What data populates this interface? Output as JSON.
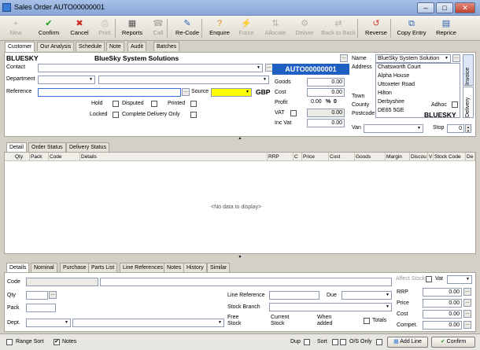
{
  "window": {
    "title": "Sales Order AUTO00000001"
  },
  "toolbar": {
    "buttons": [
      {
        "label": "New",
        "icon": "+",
        "disabled": true
      },
      {
        "label": "Confirm",
        "icon": "✔",
        "disabled": false
      },
      {
        "label": "Cancel",
        "icon": "✖",
        "disabled": false
      },
      {
        "label": "Print",
        "icon": "⎙",
        "disabled": true
      },
      {
        "label": "Reports",
        "icon": "▦",
        "disabled": false
      },
      {
        "label": "Call",
        "icon": "☎",
        "disabled": true
      },
      {
        "label": "Re-Code",
        "icon": "✎",
        "disabled": false
      },
      {
        "label": "Enquire",
        "icon": "?",
        "disabled": false
      },
      {
        "label": "Force",
        "icon": "⚡",
        "disabled": true
      },
      {
        "label": "Allocate",
        "icon": "⇅",
        "disabled": true
      },
      {
        "label": "Deliver",
        "icon": "⚙",
        "disabled": true
      },
      {
        "label": "Back to Back",
        "icon": "⇄",
        "disabled": true
      },
      {
        "label": "Reverse",
        "icon": "↺",
        "disabled": false
      },
      {
        "label": "Copy Entry",
        "icon": "⧉",
        "disabled": false
      },
      {
        "label": "Reprice",
        "icon": "▤",
        "disabled": false
      }
    ]
  },
  "main_tabs": [
    "Customer",
    "Our Analysis",
    "Schedule",
    "Note",
    "Audit",
    "Batches"
  ],
  "customer": {
    "account": "BLUESKY",
    "company": "BlueSky System Solutions",
    "contact_label": "Contact",
    "department_label": "Department",
    "reference_label": "Reference",
    "source_label": "Source",
    "currency": "GBP",
    "hold_label": "Hold",
    "disputed_label": "Disputed",
    "printed_label": "Printed",
    "locked_label": "Locked",
    "complete_label": "Complete Delivery Only"
  },
  "order": {
    "number": "AUTO00000001",
    "goods_label": "Goods",
    "goods": "0.00",
    "cost_label": "Cost",
    "cost": "0.00",
    "profit_label": "Profit",
    "profit": "0.00",
    "profit_unit": "%",
    "profit_pct": "0",
    "vat_label": "VAT",
    "vat": "0.00",
    "incvat_label": "Inc Vat",
    "incvat": "0.00"
  },
  "address": {
    "name_label": "Name",
    "name": "BlueSky System Solution",
    "address_label": "Address",
    "lines": [
      "Chatsworth Court",
      "Alpha House",
      "Uttoxeter Road",
      "Hilton",
      "Derbyshire",
      "DE65 5GE"
    ],
    "town_label": "Town",
    "county_label": "County",
    "postcode_label": "Postcode",
    "adhoc_label": "Adhoc",
    "code": "BLUESKY",
    "van_label": "Van",
    "stop_label": "Stop",
    "stop": "0",
    "side_tabs": [
      "Invoice",
      "Delivery"
    ]
  },
  "detail_tabs": [
    "Detail",
    "Order Status",
    "Delivery Status"
  ],
  "grid": {
    "columns": [
      "Qty",
      "Pack",
      "Code",
      "Details",
      "RRP",
      "C",
      "Price",
      "Cost",
      "Goods",
      "Margin",
      "Discou",
      "V",
      "Stock Code",
      "De"
    ],
    "empty": "<No data to display>"
  },
  "bottom_tabs": [
    "Details",
    "Nominal",
    "Purchase",
    "Parts List",
    "Line References",
    "Notes",
    "History",
    "Similar"
  ],
  "line": {
    "code_label": "Code",
    "qty_label": "Qty",
    "pack_label": "Pack",
    "dept_label": "Dept.",
    "line_ref_label": "Line Reference",
    "due_label": "Due",
    "stock_branch_label": "Stock Branch",
    "free_label": "Free",
    "free_label2": "Stock",
    "current_label": "Current",
    "current_label2": "Stock",
    "when_label": "When",
    "when_label2": "added",
    "totals_label": "Totals",
    "affect_label": "Affect Stock",
    "vat_label": "Vat",
    "rrp_label": "RRP",
    "rrp": "0.00",
    "price_label": "Price",
    "price": "0.00",
    "cost_label": "Cost",
    "cost": "0.00",
    "compet_label": "Compet.",
    "compet": "0.00"
  },
  "status": {
    "range_sort": "Range Sort",
    "notes": "Notes",
    "dup": "Dup",
    "sort": "Sort",
    "os_only": "O/S Only",
    "add_line": "Add Line",
    "confirm": "Confirm"
  }
}
